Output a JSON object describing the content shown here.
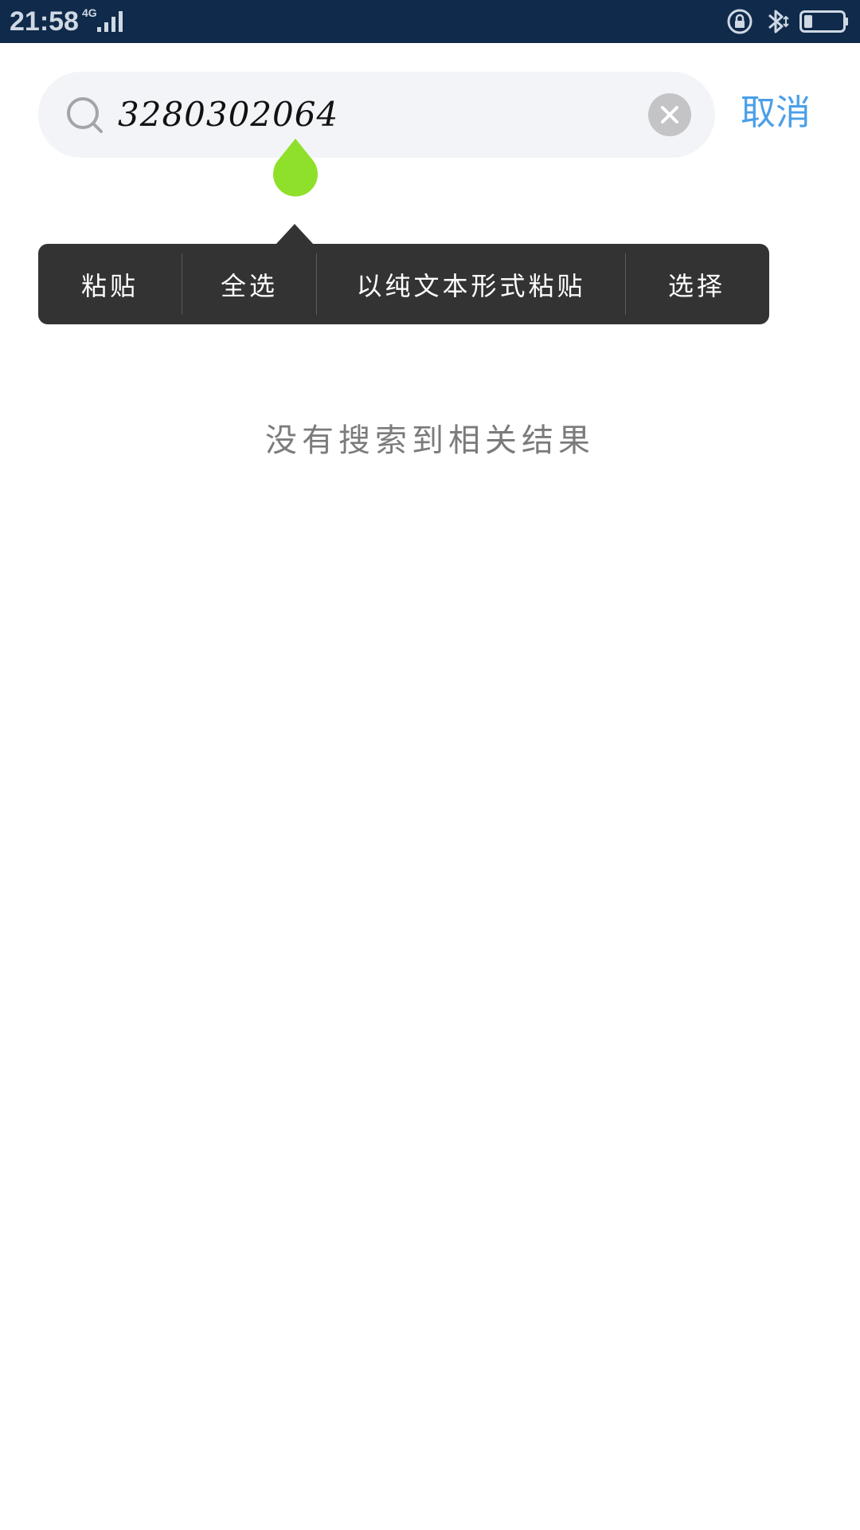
{
  "status_bar": {
    "time": "21:58",
    "network_type": "4G",
    "icons": [
      "signal-icon",
      "lock-rotation-icon",
      "bluetooth-icon",
      "battery-icon"
    ]
  },
  "search": {
    "query": "3280302064",
    "clear_icon": "close-icon",
    "cancel_label": "取消"
  },
  "context_menu": {
    "items": [
      {
        "label": "粘贴"
      },
      {
        "label": "全选"
      },
      {
        "label": "以纯文本形式粘贴"
      },
      {
        "label": "选择"
      }
    ]
  },
  "results": {
    "empty_message": "没有搜索到相关结果"
  },
  "colors": {
    "status_bar_bg": "#0f2a4a",
    "search_bg": "#f3f4f8",
    "accent": "#4a9fe8",
    "handle": "#8ee02a",
    "menu_bg": "#333333",
    "empty_text": "#7b7b7b"
  }
}
